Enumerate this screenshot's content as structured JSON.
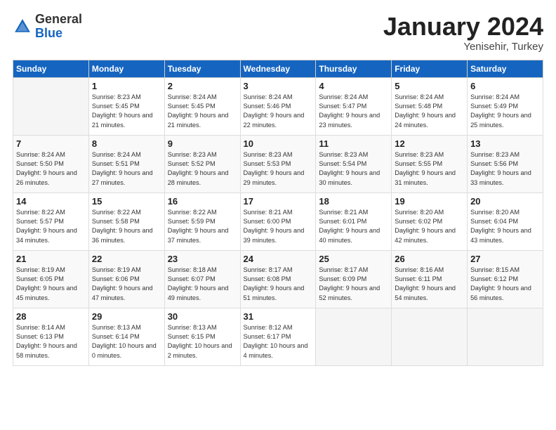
{
  "logo": {
    "general": "General",
    "blue": "Blue"
  },
  "title": "January 2024",
  "subtitle": "Yenisehir, Turkey",
  "days_header": [
    "Sunday",
    "Monday",
    "Tuesday",
    "Wednesday",
    "Thursday",
    "Friday",
    "Saturday"
  ],
  "weeks": [
    [
      {
        "day": "",
        "empty": true
      },
      {
        "day": "1",
        "sunrise": "Sunrise: 8:23 AM",
        "sunset": "Sunset: 5:45 PM",
        "daylight": "Daylight: 9 hours and 21 minutes."
      },
      {
        "day": "2",
        "sunrise": "Sunrise: 8:24 AM",
        "sunset": "Sunset: 5:45 PM",
        "daylight": "Daylight: 9 hours and 21 minutes."
      },
      {
        "day": "3",
        "sunrise": "Sunrise: 8:24 AM",
        "sunset": "Sunset: 5:46 PM",
        "daylight": "Daylight: 9 hours and 22 minutes."
      },
      {
        "day": "4",
        "sunrise": "Sunrise: 8:24 AM",
        "sunset": "Sunset: 5:47 PM",
        "daylight": "Daylight: 9 hours and 23 minutes."
      },
      {
        "day": "5",
        "sunrise": "Sunrise: 8:24 AM",
        "sunset": "Sunset: 5:48 PM",
        "daylight": "Daylight: 9 hours and 24 minutes."
      },
      {
        "day": "6",
        "sunrise": "Sunrise: 8:24 AM",
        "sunset": "Sunset: 5:49 PM",
        "daylight": "Daylight: 9 hours and 25 minutes."
      }
    ],
    [
      {
        "day": "7",
        "sunrise": "Sunrise: 8:24 AM",
        "sunset": "Sunset: 5:50 PM",
        "daylight": "Daylight: 9 hours and 26 minutes."
      },
      {
        "day": "8",
        "sunrise": "Sunrise: 8:24 AM",
        "sunset": "Sunset: 5:51 PM",
        "daylight": "Daylight: 9 hours and 27 minutes."
      },
      {
        "day": "9",
        "sunrise": "Sunrise: 8:23 AM",
        "sunset": "Sunset: 5:52 PM",
        "daylight": "Daylight: 9 hours and 28 minutes."
      },
      {
        "day": "10",
        "sunrise": "Sunrise: 8:23 AM",
        "sunset": "Sunset: 5:53 PM",
        "daylight": "Daylight: 9 hours and 29 minutes."
      },
      {
        "day": "11",
        "sunrise": "Sunrise: 8:23 AM",
        "sunset": "Sunset: 5:54 PM",
        "daylight": "Daylight: 9 hours and 30 minutes."
      },
      {
        "day": "12",
        "sunrise": "Sunrise: 8:23 AM",
        "sunset": "Sunset: 5:55 PM",
        "daylight": "Daylight: 9 hours and 31 minutes."
      },
      {
        "day": "13",
        "sunrise": "Sunrise: 8:23 AM",
        "sunset": "Sunset: 5:56 PM",
        "daylight": "Daylight: 9 hours and 33 minutes."
      }
    ],
    [
      {
        "day": "14",
        "sunrise": "Sunrise: 8:22 AM",
        "sunset": "Sunset: 5:57 PM",
        "daylight": "Daylight: 9 hours and 34 minutes."
      },
      {
        "day": "15",
        "sunrise": "Sunrise: 8:22 AM",
        "sunset": "Sunset: 5:58 PM",
        "daylight": "Daylight: 9 hours and 36 minutes."
      },
      {
        "day": "16",
        "sunrise": "Sunrise: 8:22 AM",
        "sunset": "Sunset: 5:59 PM",
        "daylight": "Daylight: 9 hours and 37 minutes."
      },
      {
        "day": "17",
        "sunrise": "Sunrise: 8:21 AM",
        "sunset": "Sunset: 6:00 PM",
        "daylight": "Daylight: 9 hours and 39 minutes."
      },
      {
        "day": "18",
        "sunrise": "Sunrise: 8:21 AM",
        "sunset": "Sunset: 6:01 PM",
        "daylight": "Daylight: 9 hours and 40 minutes."
      },
      {
        "day": "19",
        "sunrise": "Sunrise: 8:20 AM",
        "sunset": "Sunset: 6:02 PM",
        "daylight": "Daylight: 9 hours and 42 minutes."
      },
      {
        "day": "20",
        "sunrise": "Sunrise: 8:20 AM",
        "sunset": "Sunset: 6:04 PM",
        "daylight": "Daylight: 9 hours and 43 minutes."
      }
    ],
    [
      {
        "day": "21",
        "sunrise": "Sunrise: 8:19 AM",
        "sunset": "Sunset: 6:05 PM",
        "daylight": "Daylight: 9 hours and 45 minutes."
      },
      {
        "day": "22",
        "sunrise": "Sunrise: 8:19 AM",
        "sunset": "Sunset: 6:06 PM",
        "daylight": "Daylight: 9 hours and 47 minutes."
      },
      {
        "day": "23",
        "sunrise": "Sunrise: 8:18 AM",
        "sunset": "Sunset: 6:07 PM",
        "daylight": "Daylight: 9 hours and 49 minutes."
      },
      {
        "day": "24",
        "sunrise": "Sunrise: 8:17 AM",
        "sunset": "Sunset: 6:08 PM",
        "daylight": "Daylight: 9 hours and 51 minutes."
      },
      {
        "day": "25",
        "sunrise": "Sunrise: 8:17 AM",
        "sunset": "Sunset: 6:09 PM",
        "daylight": "Daylight: 9 hours and 52 minutes."
      },
      {
        "day": "26",
        "sunrise": "Sunrise: 8:16 AM",
        "sunset": "Sunset: 6:11 PM",
        "daylight": "Daylight: 9 hours and 54 minutes."
      },
      {
        "day": "27",
        "sunrise": "Sunrise: 8:15 AM",
        "sunset": "Sunset: 6:12 PM",
        "daylight": "Daylight: 9 hours and 56 minutes."
      }
    ],
    [
      {
        "day": "28",
        "sunrise": "Sunrise: 8:14 AM",
        "sunset": "Sunset: 6:13 PM",
        "daylight": "Daylight: 9 hours and 58 minutes."
      },
      {
        "day": "29",
        "sunrise": "Sunrise: 8:13 AM",
        "sunset": "Sunset: 6:14 PM",
        "daylight": "Daylight: 10 hours and 0 minutes."
      },
      {
        "day": "30",
        "sunrise": "Sunrise: 8:13 AM",
        "sunset": "Sunset: 6:15 PM",
        "daylight": "Daylight: 10 hours and 2 minutes."
      },
      {
        "day": "31",
        "sunrise": "Sunrise: 8:12 AM",
        "sunset": "Sunset: 6:17 PM",
        "daylight": "Daylight: 10 hours and 4 minutes."
      },
      {
        "day": "",
        "empty": true
      },
      {
        "day": "",
        "empty": true
      },
      {
        "day": "",
        "empty": true
      }
    ]
  ]
}
